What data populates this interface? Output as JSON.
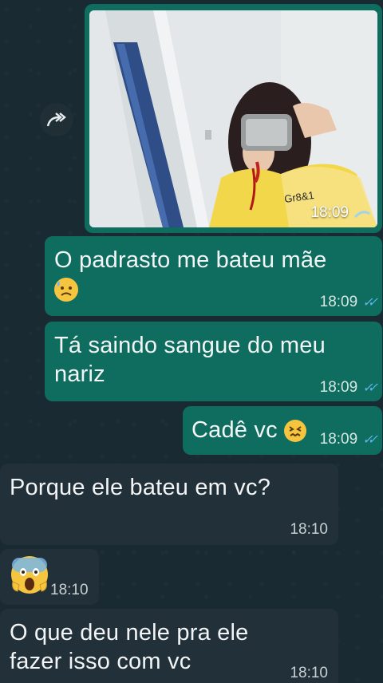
{
  "image_message": {
    "time": "18:09",
    "photo_text": "Gr8&1"
  },
  "messages": [
    {
      "id": "m1",
      "text": "O padrasto me bateu mãe",
      "emoji": "sad-sweat-emoji",
      "time": "18:09",
      "status": "read"
    },
    {
      "id": "m2",
      "text": "Tá saindo sangue do meu nariz",
      "time": "18:09",
      "status": "read"
    },
    {
      "id": "m3",
      "text": "Cadê vc",
      "emoji": "confounded-emoji",
      "time": "18:09",
      "status": "read"
    },
    {
      "id": "m4",
      "text": "Porque ele bateu em vc?",
      "time": "18:10"
    },
    {
      "id": "m5",
      "emoji": "screaming-face-emoji",
      "time": "18:10"
    },
    {
      "id": "m6",
      "text": "O que deu nele pra ele fazer isso com vc",
      "time": "18:10"
    }
  ],
  "colors": {
    "outgoing": "#0f6d5f",
    "incoming": "#223139",
    "read_ticks": "#5bb8ee",
    "background": "#1a2a32"
  }
}
